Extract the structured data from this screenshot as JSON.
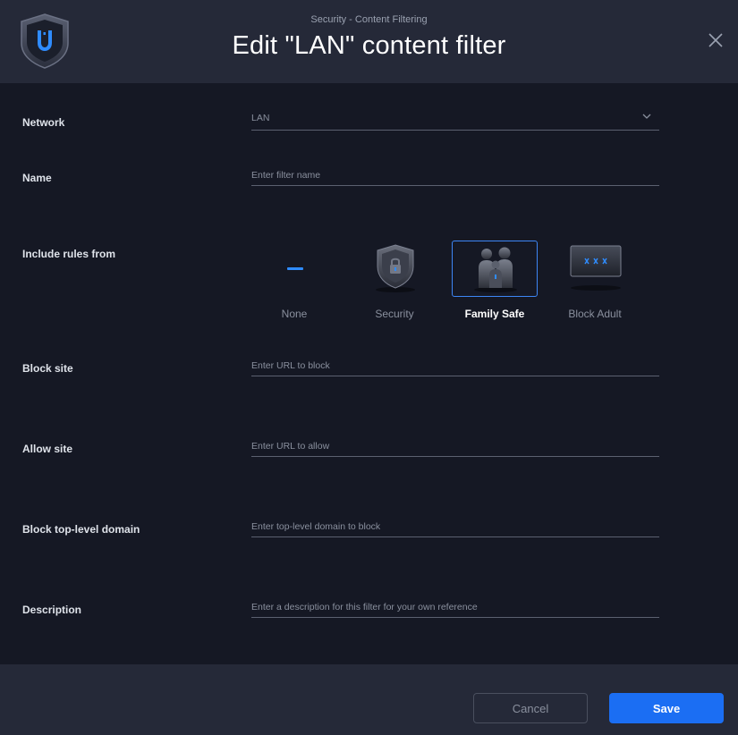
{
  "header": {
    "subtitle": "Security - Content Filtering",
    "title": "Edit \"LAN\" content filter"
  },
  "form": {
    "network": {
      "label": "Network",
      "value": "LAN"
    },
    "name": {
      "label": "Name",
      "placeholder": "Enter filter name",
      "value": ""
    },
    "include_rules": {
      "label": "Include rules from",
      "options": [
        {
          "label": "None",
          "icon": "none-dash-icon",
          "selected": false
        },
        {
          "label": "Security",
          "icon": "shield-lock-icon",
          "selected": false
        },
        {
          "label": "Family Safe",
          "icon": "family-icon",
          "selected": true
        },
        {
          "label": "Block Adult",
          "icon": "xxx-screen-icon",
          "selected": false
        }
      ]
    },
    "block_site": {
      "label": "Block site",
      "placeholder": "Enter URL to block",
      "value": ""
    },
    "allow_site": {
      "label": "Allow site",
      "placeholder": "Enter URL to allow",
      "value": ""
    },
    "block_tld": {
      "label": "Block top-level domain",
      "placeholder": "Enter top-level domain to block",
      "value": ""
    },
    "description": {
      "label": "Description",
      "placeholder": "Enter a description for this filter for your own reference",
      "value": ""
    }
  },
  "footer": {
    "cancel_label": "Cancel",
    "save_label": "Save"
  },
  "colors": {
    "background": "#151824",
    "panel": "#252938",
    "accent": "#1b6ef3",
    "selected_border": "#3d86f5"
  }
}
